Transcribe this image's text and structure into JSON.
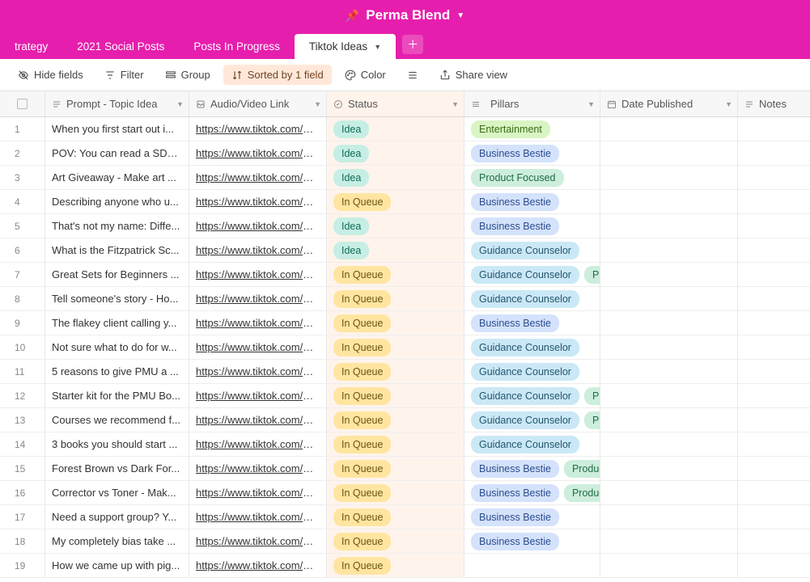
{
  "header": {
    "title": "Perma Blend",
    "tabs": [
      "trategy",
      "2021 Social Posts",
      "Posts In Progress",
      "Tiktok Ideas"
    ],
    "active_tab_index": 3
  },
  "toolbar": {
    "hide_fields": "Hide fields",
    "filter": "Filter",
    "group": "Group",
    "sorted": "Sorted by 1 field",
    "color": "Color",
    "share": "Share view"
  },
  "columns": {
    "prompt": "Prompt - Topic Idea",
    "link": "Audio/Video Link",
    "status": "Status",
    "pillars": "Pillars",
    "date": "Date Published",
    "notes": "Notes"
  },
  "status_labels": {
    "idea": "Idea",
    "queue": "In Queue"
  },
  "pillar_labels": {
    "ent": "Entertainment",
    "biz": "Business Bestie",
    "prod": "Product Focused",
    "guid": "Guidance Counselor",
    "product": "Product",
    "prod_trunc": "Prod"
  },
  "rows": [
    {
      "n": 1,
      "prompt": "When you first start out i...",
      "link": "https://www.tiktok.com/m...",
      "status": "idea",
      "pillars": [
        "ent"
      ]
    },
    {
      "n": 2,
      "prompt": "POV: You can read a SDS ...",
      "link": "https://www.tiktok.com/m...",
      "status": "idea",
      "pillars": [
        "biz"
      ]
    },
    {
      "n": 3,
      "prompt": "Art Giveaway - Make art ...",
      "link": "https://www.tiktok.com/@...",
      "status": "idea",
      "pillars": [
        "prod"
      ]
    },
    {
      "n": 4,
      "prompt": "Describing anyone who u...",
      "link": "https://www.tiktok.com/@...",
      "status": "queue",
      "pillars": [
        "biz"
      ]
    },
    {
      "n": 5,
      "prompt": "That's not my name: Diffe...",
      "link": "https://www.tiktok.com/@...",
      "status": "idea",
      "pillars": [
        "biz"
      ]
    },
    {
      "n": 6,
      "prompt": "What is the Fitzpatrick Sc...",
      "link": "https://www.tiktok.com/@...",
      "status": "idea",
      "pillars": [
        "guid"
      ]
    },
    {
      "n": 7,
      "prompt": "Great Sets for Beginners ...",
      "link": "https://www.tiktok.com/@...",
      "status": "queue",
      "pillars": [
        "guid",
        "prod_trunc"
      ]
    },
    {
      "n": 8,
      "prompt": "Tell someone's story - Ho...",
      "link": "https://www.tiktok.com/@...",
      "status": "queue",
      "pillars": [
        "guid"
      ]
    },
    {
      "n": 9,
      "prompt": "The flakey client calling y...",
      "link": "https://www.tiktok.com/@...",
      "status": "queue",
      "pillars": [
        "biz"
      ]
    },
    {
      "n": 10,
      "prompt": "Not sure what to do for w...",
      "link": "https://www.tiktok.com/@...",
      "status": "queue",
      "pillars": [
        "guid"
      ]
    },
    {
      "n": 11,
      "prompt": "5 reasons to give PMU a ...",
      "link": "https://www.tiktok.com/@...",
      "status": "queue",
      "pillars": [
        "guid"
      ]
    },
    {
      "n": 12,
      "prompt": "Starter kit for the PMU Bo...",
      "link": "https://www.tiktok.com/@...",
      "status": "queue",
      "pillars": [
        "guid",
        "prod_trunc"
      ]
    },
    {
      "n": 13,
      "prompt": "Courses we recommend f...",
      "link": "https://www.tiktok.com/@...",
      "status": "queue",
      "pillars": [
        "guid",
        "prod_trunc"
      ]
    },
    {
      "n": 14,
      "prompt": "3 books you should start ...",
      "link": "https://www.tiktok.com/@...",
      "status": "queue",
      "pillars": [
        "guid"
      ]
    },
    {
      "n": 15,
      "prompt": "Forest Brown vs Dark For...",
      "link": "https://www.tiktok.com/@...",
      "status": "queue",
      "pillars": [
        "biz",
        "product"
      ]
    },
    {
      "n": 16,
      "prompt": "Corrector vs Toner - Mak...",
      "link": "https://www.tiktok.com/@...",
      "status": "queue",
      "pillars": [
        "biz",
        "product"
      ]
    },
    {
      "n": 17,
      "prompt": "Need a support group? Y...",
      "link": "https://www.tiktok.com/@...",
      "status": "queue",
      "pillars": [
        "biz"
      ]
    },
    {
      "n": 18,
      "prompt": "My completely bias take ...",
      "link": "https://www.tiktok.com/@...",
      "status": "queue",
      "pillars": [
        "biz"
      ]
    },
    {
      "n": 19,
      "prompt": "How we came up with pig...",
      "link": "https://www.tiktok.com/@...",
      "status": "queue",
      "pillars": []
    }
  ]
}
